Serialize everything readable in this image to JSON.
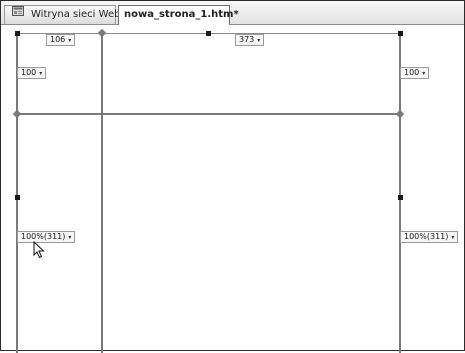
{
  "tabs": [
    {
      "label": "Witryna sieci Web",
      "icon": "website-icon",
      "active": false
    },
    {
      "label": "nowa_strona_1.htm*",
      "active": true
    }
  ],
  "layout_table": {
    "column_widths": {
      "left": "106",
      "right": "373"
    },
    "row_heights": {
      "top_left": "100",
      "top_right": "100",
      "main_left": "100%(311)",
      "main_right": "100%(311)"
    },
    "dropdown_arrow": "▾"
  }
}
